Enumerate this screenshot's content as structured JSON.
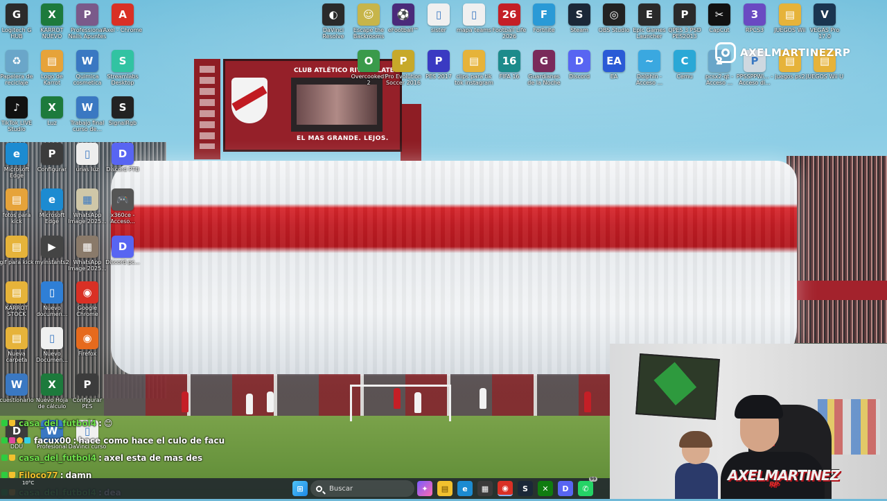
{
  "wallpaper": {
    "scoreboard_title": "CLUB ATLÉTICO RIVER PLATE",
    "scoreboard_motto": "EL MAS GRANDE. LEJOS."
  },
  "desktop_icons": [
    {
      "label": "Logitech G HUB",
      "color": "#2b2b2b",
      "glyph": "G"
    },
    {
      "label": "KARROT NUEVO",
      "color": "#1d7a3c",
      "glyph": "X"
    },
    {
      "label": "Professional Nails Apuntes",
      "color": "#7a5a8a",
      "glyph": "P"
    },
    {
      "label": "Axel - Chrome",
      "color": "#d93025",
      "glyph": "A"
    },
    {
      "label": "Papelera de reciclaje",
      "color": "#6aa6c9",
      "glyph": "♻"
    },
    {
      "label": "Logo de Karrot",
      "color": "#e6a33a",
      "glyph": "▤"
    },
    {
      "label": "Quimica cosmetica",
      "color": "#3a78c2",
      "glyph": "W"
    },
    {
      "label": "Streamlabs Desktop",
      "color": "#31c3a2",
      "glyph": "S"
    },
    {
      "label": "TikTok LIVE Studio",
      "color": "#111111",
      "glyph": "♪"
    },
    {
      "label": "Luz",
      "color": "#1d7a3c",
      "glyph": "X"
    },
    {
      "label": "Trabajo final curso de...",
      "color": "#3a78c2",
      "glyph": "W"
    },
    {
      "label": "SignalRgb",
      "color": "#222222",
      "glyph": "S"
    },
    {
      "label": "Microsoft Edge",
      "color": "#1c8bd1",
      "glyph": "e"
    },
    {
      "label": "Configurar",
      "color": "#3c3c3c",
      "glyph": "P"
    },
    {
      "label": "unas luz",
      "color": "#eeeeee",
      "glyph": "▯"
    },
    {
      "label": "Discord PTB",
      "color": "#5865f2",
      "glyph": "D"
    },
    {
      "label": "fotos para kick",
      "color": "#e6a33a",
      "glyph": "▤"
    },
    {
      "label": "Microsoft Edge",
      "color": "#1c8bd1",
      "glyph": "e"
    },
    {
      "label": "WhatsApp Image 2025...",
      "color": "#cfc7a8",
      "glyph": "▦"
    },
    {
      "label": "x360ce - Acceso...",
      "color": "#555555",
      "glyph": "🎮"
    },
    {
      "label": "gif para kick",
      "color": "#e6b33a",
      "glyph": "▤"
    },
    {
      "label": "myinstants2",
      "color": "#444444",
      "glyph": "▶"
    },
    {
      "label": "WhatsApp Image 2025...",
      "color": "#8a7a6a",
      "glyph": "▦"
    },
    {
      "label": "Discord pc...",
      "color": "#5865f2",
      "glyph": "D"
    },
    {
      "label": "KARROT STOCK",
      "color": "#e6b33a",
      "glyph": "▤"
    },
    {
      "label": "Nuevo documen...",
      "color": "#2f7fd6",
      "glyph": "▯"
    },
    {
      "label": "Google Chrome",
      "color": "#d93025",
      "glyph": "◉"
    },
    {
      "label": "Nueva carpeta",
      "color": "#e6b33a",
      "glyph": "▤"
    },
    {
      "label": "Nuevo Documen...",
      "color": "#f0f0f0",
      "glyph": "▯"
    },
    {
      "label": "Firefox",
      "color": "#e66a1d",
      "glyph": "◉"
    },
    {
      "label": "cuestionario",
      "color": "#3a78c2",
      "glyph": "W"
    },
    {
      "label": "Nuevo Hoja de cálculo",
      "color": "#1d7a3c",
      "glyph": "X"
    },
    {
      "label": "Configurar PES",
      "color": "#3c3c3c",
      "glyph": "P"
    },
    {
      "label": "DDU",
      "color": "#3c3c3c",
      "glyph": "D"
    },
    {
      "label": "Profesional",
      "color": "#3a78c2",
      "glyph": "W"
    },
    {
      "label": "DaVinci curso",
      "color": "#f0f0f0",
      "glyph": "▯"
    },
    {
      "label": "DaVinci Resolve",
      "color": "#2a2a2a",
      "glyph": "◐"
    },
    {
      "label": "Escape the Backrooms",
      "color": "#c7b54a",
      "glyph": "☺"
    },
    {
      "label": "eFootball™",
      "color": "#4a2a7a",
      "glyph": "⚽"
    },
    {
      "label": "sister",
      "color": "#f0f0f0",
      "glyph": "▯"
    },
    {
      "label": "mapa teams",
      "color": "#f0f0f0",
      "glyph": "▯"
    },
    {
      "label": "Football Life 2026",
      "color": "#c41f26",
      "glyph": "26"
    },
    {
      "label": "Fortnite",
      "color": "#2a9ad6",
      "glyph": "F"
    },
    {
      "label": "Steam",
      "color": "#1b2838",
      "glyph": "S"
    },
    {
      "label": "OBS Studio",
      "color": "#222222",
      "glyph": "◎"
    },
    {
      "label": "Epic Games Launcher",
      "color": "#2a2a2a",
      "glyph": "E"
    },
    {
      "label": "QPES 3 PSD PES2013",
      "color": "#2a2a2a",
      "glyph": "P"
    },
    {
      "label": "CapCut",
      "color": "#111111",
      "glyph": "✂"
    },
    {
      "label": "RPCS3",
      "color": "#6a4ac2",
      "glyph": "3"
    },
    {
      "label": "JUEGOS Wii",
      "color": "#e6b33a",
      "glyph": "▤"
    },
    {
      "label": "VEGAS Pro 17.0",
      "color": "#1a3550",
      "glyph": "V"
    },
    {
      "label": "Overcooked! 2",
      "color": "#3a9a4a",
      "glyph": "O"
    },
    {
      "label": "Pro Evolution Soccer 2016",
      "color": "#c7a92a",
      "glyph": "P"
    },
    {
      "label": "PES 2017",
      "color": "#3a3ac2",
      "glyph": "P"
    },
    {
      "label": "clips para tik tok instagram",
      "color": "#e6b33a",
      "glyph": "▤"
    },
    {
      "label": "FIFA 16",
      "color": "#1c8b8b",
      "glyph": "16"
    },
    {
      "label": "Guardianes de la Noche",
      "color": "#7a2a5a",
      "glyph": "G"
    },
    {
      "label": "Discord",
      "color": "#5865f2",
      "glyph": "D"
    },
    {
      "label": "EA",
      "color": "#2a5ad6",
      "glyph": "EA"
    },
    {
      "label": "Dolphin - Acceso ...",
      "color": "#3aa8e0",
      "glyph": "~"
    },
    {
      "label": "Cemu",
      "color": "#2aa8d6",
      "glyph": "C"
    },
    {
      "label": "pcsx2-qt - Acceso ...",
      "color": "#6aa6c9",
      "glyph": "2"
    },
    {
      "label": "PPSSPPWi... - Acceso di...",
      "color": "#cfd8e0",
      "glyph": "P"
    },
    {
      "label": "juegos ps2",
      "color": "#e6b33a",
      "glyph": "▤"
    },
    {
      "label": "JUEGOS Wii U",
      "color": "#e6b33a",
      "glyph": "▤"
    }
  ],
  "watermark": {
    "icon": "instagram-icon",
    "handle": "AXELMARTINEZRP"
  },
  "chat": [
    {
      "user": "casa_del_futbol4",
      "sep": " : ",
      "text": "😊",
      "user_color": "#6fe04a"
    },
    {
      "user": "facux00",
      "sep": ": ",
      "text": "hace como hace el culo de facu",
      "user_color": "#ffffff"
    },
    {
      "user": "casa_del_futbol4",
      "sep": " : ",
      "text": "axel esta de mas des",
      "user_color": "#6fe04a"
    },
    {
      "user": "Filoco77",
      "sep": " : ",
      "text": "damn",
      "user_color": "#f2c12e"
    },
    {
      "user": "casa_del_futbol4",
      "sep": " : ",
      "text": "dea",
      "user_color": "#6fe04a"
    }
  ],
  "taskbar": {
    "weather_temp": "10°C",
    "search_placeholder": "Buscar",
    "notification_count": "99",
    "apps": [
      "start-icon",
      "search",
      "copilot-icon",
      "file-explorer-icon",
      "edge-icon",
      "store-icon",
      "chrome-icon",
      "steam-icon",
      "xbox-icon",
      "discord-icon",
      "whatsapp-icon"
    ]
  },
  "webcam": {
    "logo_top": "AXELMARTINEZ",
    "logo_bottom": "RP"
  }
}
